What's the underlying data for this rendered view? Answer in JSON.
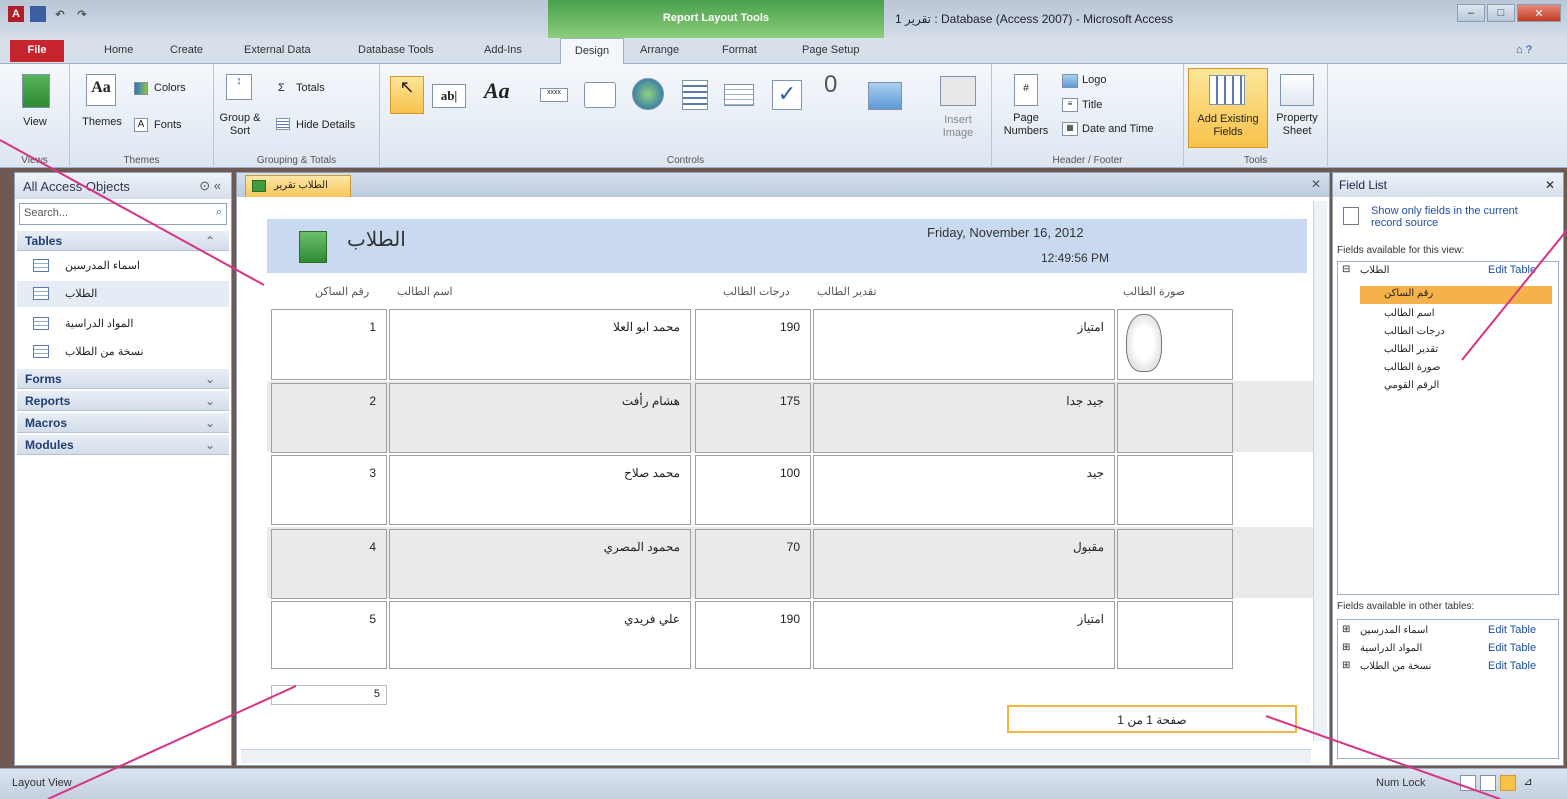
{
  "title_bar": {
    "context_group": "Report Layout Tools",
    "window_title": "تقرير 1 : Database (Access 2007) - Microsoft Access"
  },
  "ribbon_tabs": {
    "file": "File",
    "home": "Home",
    "create": "Create",
    "external_data": "External Data",
    "database_tools": "Database Tools",
    "add_ins": "Add-Ins",
    "design": "Design",
    "arrange": "Arrange",
    "format": "Format",
    "page_setup": "Page Setup"
  },
  "ribbon": {
    "view": "View",
    "views_group": "Views",
    "themes": "Themes",
    "colors": "Colors",
    "fonts": "Fonts",
    "themes_group": "Themes",
    "group_sort": "Group & Sort",
    "totals": "Totals",
    "hide_details": "Hide Details",
    "grouping_group": "Grouping & Totals",
    "controls_group": "Controls",
    "insert_image": "Insert Image",
    "page_numbers": "Page Numbers",
    "logo": "Logo",
    "title": "Title",
    "date_time": "Date and Time",
    "header_footer_group": "Header / Footer",
    "add_existing_fields": "Add Existing Fields",
    "property_sheet": "Property Sheet",
    "tools_group": "Tools"
  },
  "nav_pane": {
    "header": "All Access Objects",
    "search_placeholder": "Search...",
    "tables_label": "Tables",
    "tables": [
      "اسماء المدرسين",
      "الطلاب",
      "المواد الدراسية",
      "نسخة من الطلاب"
    ],
    "forms_label": "Forms",
    "reports_label": "Reports",
    "macros_label": "Macros",
    "modules_label": "Modules"
  },
  "document": {
    "tab_title": "الطلاب تقرير",
    "report_title": "الطلاب",
    "date": "Friday, November 16, 2012",
    "time": "12:49:56 PM",
    "columns": {
      "seat": "رقم الساكن",
      "name": "اسم الطالب",
      "score": "درجات الطالب",
      "grade": "تقدير الطالب",
      "photo": "صورة الطالب"
    },
    "rows": [
      {
        "seat": "1",
        "name": "محمد ابو العلا",
        "score": "190",
        "grade": "امتياز"
      },
      {
        "seat": "2",
        "name": "هشام رأفت",
        "score": "175",
        "grade": "جيد جدا"
      },
      {
        "seat": "3",
        "name": "محمد صلاح",
        "score": "100",
        "grade": "جيد"
      },
      {
        "seat": "4",
        "name": "محمود المصري",
        "score": "70",
        "grade": "مقبول"
      },
      {
        "seat": "5",
        "name": "علي فريدي",
        "score": "190",
        "grade": "امتياز"
      }
    ],
    "count_total": "5",
    "page_footer": "صفحة 1 من 1"
  },
  "field_list": {
    "header": "Field List",
    "show_only": "Show only fields in the current record source",
    "available_view": "Fields available for this view:",
    "table_name": "الطلاب",
    "edit_table": "Edit Table",
    "fields": [
      "رقم الساكن",
      "اسم الطالب",
      "درجات الطالب",
      "تقدير الطالب",
      "صورة الطالب",
      "الرقم القومي"
    ],
    "available_other": "Fields available in other tables:",
    "other_tables": [
      "اسماء المدرسين",
      "المواد الدراسية",
      "نسخة من الطلاب"
    ]
  },
  "status_bar": {
    "left": "Layout View",
    "num_lock": "Num Lock"
  },
  "colors": {
    "accent_green": "#4aa04c",
    "file_red": "#c8242d",
    "highlight_orange": "#f6c65b"
  }
}
